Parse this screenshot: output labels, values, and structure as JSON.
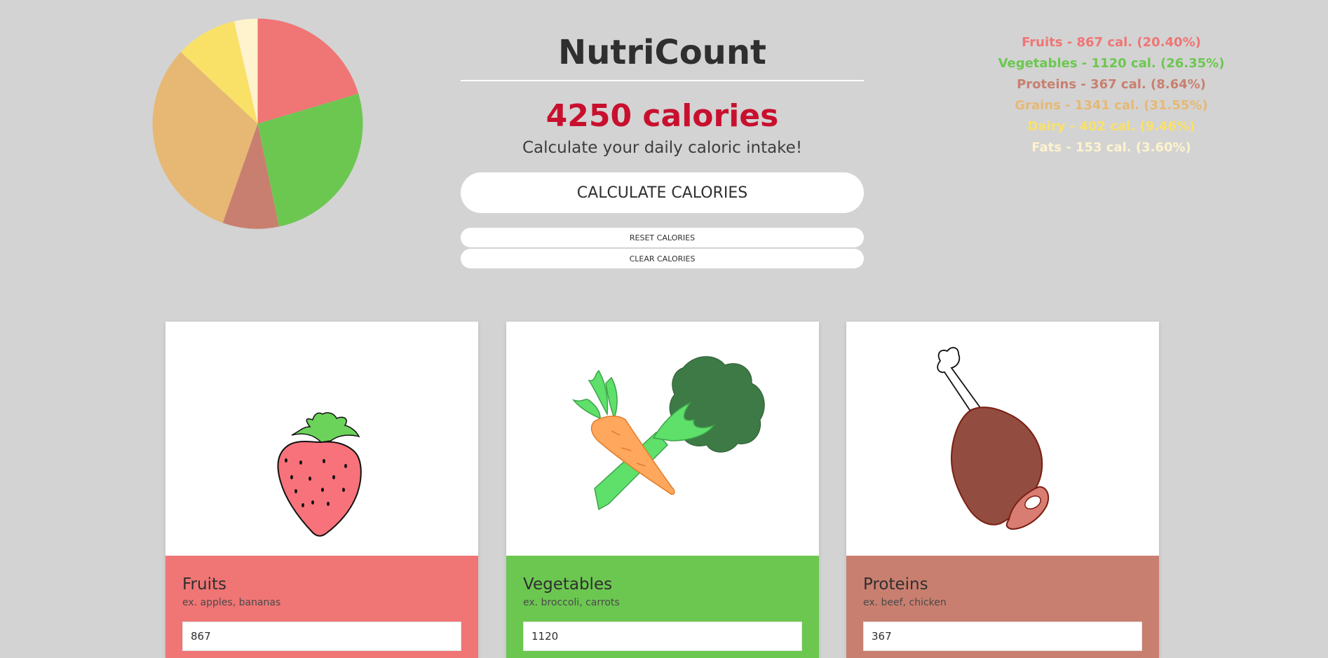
{
  "app": {
    "title": "NutriCount",
    "total_calories": "4250 calories",
    "tagline": "Calculate your daily caloric intake!"
  },
  "buttons": {
    "calculate": "CALCULATE CALORIES",
    "reset": "RESET CALORIES",
    "clear": "CLEAR CALORIES"
  },
  "legend": [
    {
      "text": "Fruits - 867 cal. (20.40%)",
      "color": "#f07575"
    },
    {
      "text": "Vegetables - 1120 cal. (26.35%)",
      "color": "#6cc751"
    },
    {
      "text": "Proteins - 367 cal. (8.64%)",
      "color": "#c97f6f"
    },
    {
      "text": "Grains - 1341 cal. (31.55%)",
      "color": "#e6b874"
    },
    {
      "text": "Dairy - 402 cal. (9.46%)",
      "color": "#f9e168"
    },
    {
      "text": "Fats - 153 cal. (3.60%)",
      "color": "#fff3cd"
    }
  ],
  "chart_data": {
    "type": "pie",
    "categories": [
      "Fruits",
      "Vegetables",
      "Proteins",
      "Grains",
      "Dairy",
      "Fats"
    ],
    "values": [
      867,
      1120,
      367,
      1341,
      402,
      153
    ],
    "colors": [
      "#f07575",
      "#6cc751",
      "#c97f6f",
      "#e6b874",
      "#f9e168",
      "#fff3cd"
    ]
  },
  "cards": [
    {
      "title": "Fruits",
      "example": "ex. apples, bananas",
      "value": "867",
      "color": "#f07575",
      "icon": "strawberry-icon"
    },
    {
      "title": "Vegetables",
      "example": "ex. broccoli, carrots",
      "value": "1120",
      "color": "#6cc751",
      "icon": "vegetables-icon"
    },
    {
      "title": "Proteins",
      "example": "ex. beef, chicken",
      "value": "367",
      "color": "#c97f6f",
      "icon": "meat-drumstick-icon"
    }
  ]
}
